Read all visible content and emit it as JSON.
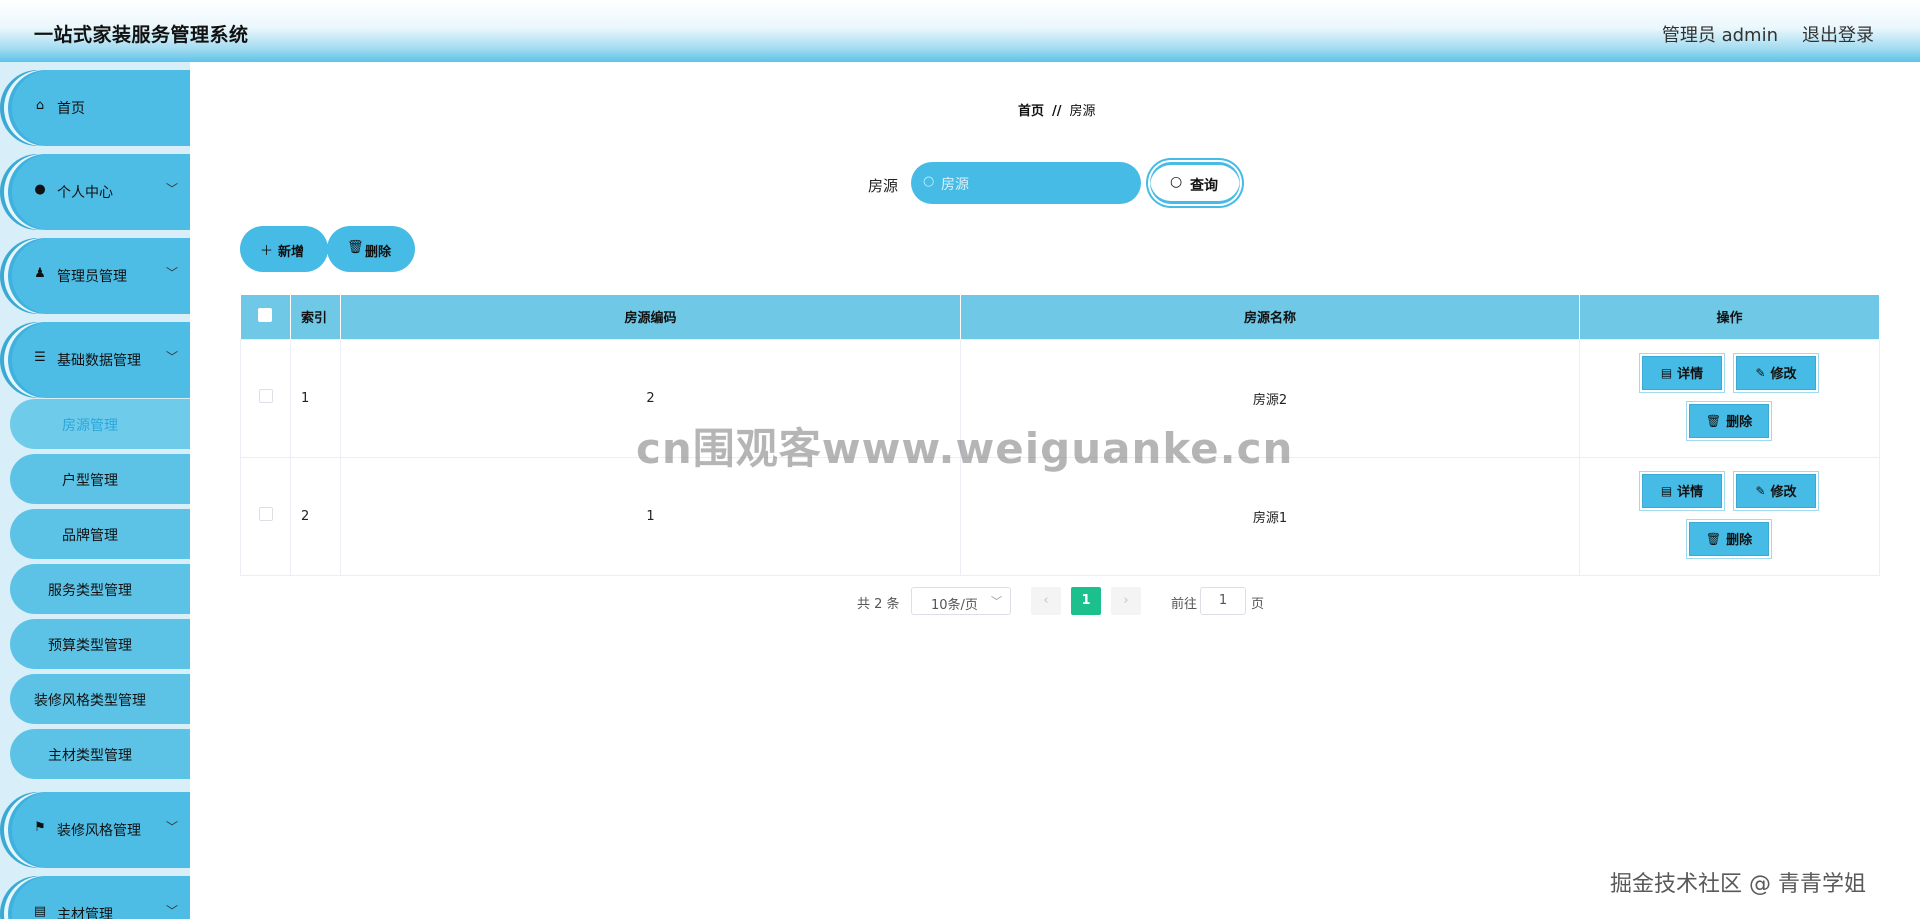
{
  "header": {
    "title": "一站式家装服务管理系统",
    "admin": "管理员 admin",
    "logout": "退出登录"
  },
  "sidebar": {
    "items": [
      {
        "label": "首页",
        "icon": "home-icon"
      },
      {
        "label": "个人中心",
        "icon": "user-icon"
      },
      {
        "label": "管理员管理",
        "icon": "admin-icon"
      },
      {
        "label": "基础数据管理",
        "icon": "list-icon"
      },
      {
        "label": "装修风格管理",
        "icon": "flag-icon"
      },
      {
        "label": "主材管理",
        "icon": "clipboard-icon"
      }
    ],
    "sub_items": [
      "房源管理",
      "户型管理",
      "品牌管理",
      "服务类型管理",
      "预算类型管理",
      "装修风格类型管理",
      "主材类型管理"
    ]
  },
  "breadcrumb": {
    "home": "首页",
    "sep": "//",
    "current": "房源"
  },
  "search": {
    "label": "房源",
    "placeholder": "房源",
    "button": "查询"
  },
  "actions": {
    "add": "新增",
    "delete": "删除"
  },
  "table": {
    "headers": [
      "索引",
      "房源编码",
      "房源名称",
      "操作"
    ],
    "rows": [
      {
        "index": "1",
        "code": "2",
        "name": "房源2"
      },
      {
        "index": "2",
        "code": "1",
        "name": "房源1"
      }
    ],
    "row_actions": {
      "detail": "详情",
      "edit": "修改",
      "delete": "删除"
    }
  },
  "pagination": {
    "total": "共 2 条",
    "page_size": "10条/页",
    "current_page": "1",
    "goto_label": "前往",
    "goto_value": "1",
    "page_word": "页"
  },
  "watermarks": {
    "center": "cn围观客www.weiguanke.cn",
    "corner": "掘金技术社区 @ 青青学姐"
  },
  "colors": {
    "accent": "#45bbe6",
    "header_gradient_end": "#5cc3e8",
    "active_page": "#1bc08c",
    "table_header": "#6ec8e6"
  }
}
